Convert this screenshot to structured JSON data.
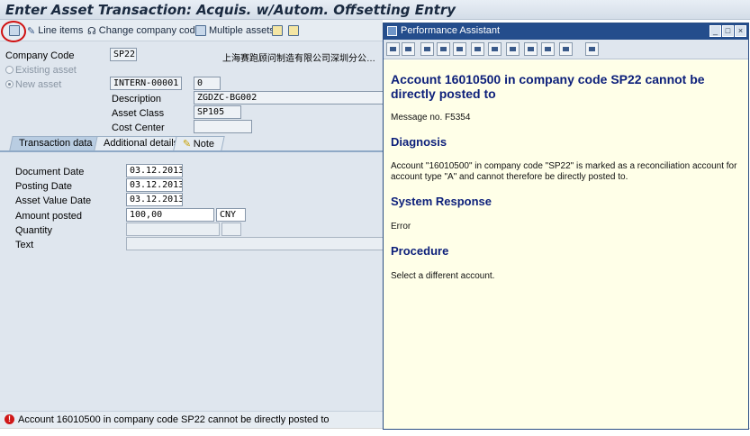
{
  "window": {
    "title": "Enter Asset Transaction: Acquis. w/Autom. Offsetting Entry"
  },
  "toolbar": {
    "line_items": "Line items",
    "change_company_code": "Change company code",
    "multiple_assets": "Multiple assets"
  },
  "header": {
    "company_code_label": "Company Code",
    "company_code_value": "SP22",
    "company_name": "上海赛跑顾问制造有限公司深圳分公…",
    "existing_asset_label": "Existing asset",
    "new_asset_label": "New asset",
    "new_asset_value": "INTERN-00001",
    "new_asset_sub": "0",
    "description_label": "Description",
    "description_value": "ZGDZC-BG002",
    "asset_class_label": "Asset Class",
    "asset_class_value": "SP105",
    "cost_center_label": "Cost Center",
    "cost_center_value": ""
  },
  "tabs": [
    {
      "label": "Transaction data",
      "active": true
    },
    {
      "label": "Additional details",
      "active": false
    },
    {
      "label": "Note",
      "active": false
    }
  ],
  "transaction": {
    "document_date_label": "Document Date",
    "document_date": "03.12.2013",
    "posting_date_label": "Posting Date",
    "posting_date": "03.12.2013",
    "asset_value_date_label": "Asset Value Date",
    "asset_value_date": "03.12.2013",
    "amount_posted_label": "Amount posted",
    "amount_posted": "100,00",
    "currency": "CNY",
    "quantity_label": "Quantity",
    "text_label": "Text"
  },
  "status": {
    "message": "Account 16010500 in company code SP22 cannot be directly posted to"
  },
  "assistant": {
    "window_title": "Performance Assistant",
    "heading": "Account 16010500 in company code SP22 cannot be directly posted to",
    "message_no": "Message no. F5354",
    "diagnosis_title": "Diagnosis",
    "diagnosis_text": "Account \"16010500\" in company code \"SP22\" is marked as a reconciliation account for account type \"A\" and cannot therefore be directly posted to.",
    "system_response_title": "System Response",
    "system_response_text": "Error",
    "procedure_title": "Procedure",
    "procedure_text": "Select a different account."
  },
  "colors": {
    "heading": "#0c1f7a",
    "pa_titlebar": "#244d8c",
    "error": "#d01818",
    "highlight_circle": "#d01010"
  }
}
